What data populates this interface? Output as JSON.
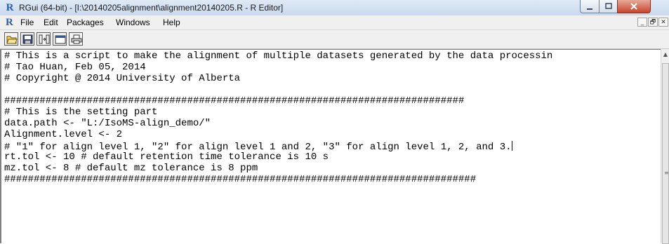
{
  "window": {
    "title": "RGui (64-bit) - [I:\\20140205alignment\\alignment20140205.R - R Editor]",
    "app_icon": "R",
    "min_icon": "minimize-icon",
    "max_icon": "maximize-icon",
    "close_icon": "close-icon"
  },
  "menubar": {
    "icon": "R",
    "items": [
      "File",
      "Edit",
      "Packages",
      "Windows",
      "Help"
    ],
    "mdi_buttons": [
      "_",
      "🗗",
      "✕"
    ]
  },
  "toolbar": {
    "buttons": [
      "open-file-icon",
      "save-icon",
      "run-line-icon",
      "console-icon",
      "print-icon"
    ]
  },
  "editor": {
    "lines": [
      "# This is a script to make the alignment of multiple datasets generated by the data processin",
      "# Tao Huan, Feb 05, 2014",
      "# Copyright @ 2014 University of Alberta",
      "",
      "##############################################################################",
      "# This is the setting part",
      "data.path <- \"L:/IsoMS-align_demo/\"",
      "Alignment.level <- 2",
      "# \"1\" for align level 1, \"2\" for align level 1 and 2, \"3\" for align level 1, 2, and 3.",
      "rt.tol <- 10 # default retention time tolerance is 10 s",
      "mz.tol <- 8 # default mz tolerance is 8 ppm",
      "################################################################################"
    ]
  },
  "scrollbar": {
    "up_arrow": "▲",
    "grip": "≡"
  }
}
